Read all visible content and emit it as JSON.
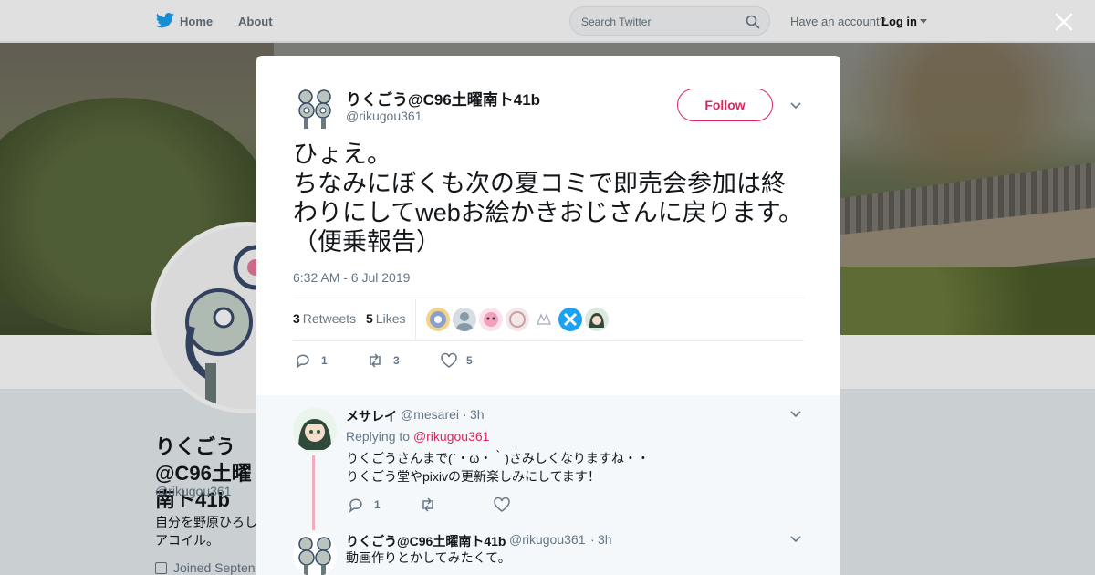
{
  "nav": {
    "home_label": "Home",
    "about_label": "About",
    "search_placeholder": "Search Twitter",
    "have_account": "Have an account?",
    "login_label": "Log in"
  },
  "profile": {
    "name": "りくごう@C96土曜南ト41b",
    "handle": "@rikugou361",
    "bio": "自分を野原ひろしアコイル。",
    "joined": "Joined Septen"
  },
  "tweet": {
    "author_name": "りくごう@C96土曜南ト41b",
    "author_handle": "@rikugou361",
    "follow_label": "Follow",
    "text": "ひょえ。\nちなみにぼくも次の夏コミで即売会参加は終わりにしてwebお絵かきおじさんに戻ります。（便乗報告）",
    "timestamp": "6:32 AM - 6 Jul 2019",
    "retweets_count": "3",
    "retweets_label": "Retweets",
    "likes_count": "5",
    "likes_label": "Likes",
    "reply_count": "1",
    "retweet_action_count": "3",
    "like_action_count": "5"
  },
  "replies": [
    {
      "name": "メサレイ",
      "handle": "@mesarei",
      "time": "3h",
      "replying_prefix": "Replying to",
      "replying_to": "@rikugou361",
      "text": "りくごうさんまで(´・ω・｀)さみしくなりますね・・\nりくごう堂やpixivの更新楽しみにしてます！",
      "reply_count": "1"
    },
    {
      "name": "りくごう@C96土曜南ト41b",
      "handle": "@rikugou361",
      "time": "3h",
      "text": "動画作りとかしてみたくて。"
    }
  ],
  "colors": {
    "accent": "#e0245e",
    "twitter_blue": "#1da1f2",
    "muted": "#657786"
  }
}
